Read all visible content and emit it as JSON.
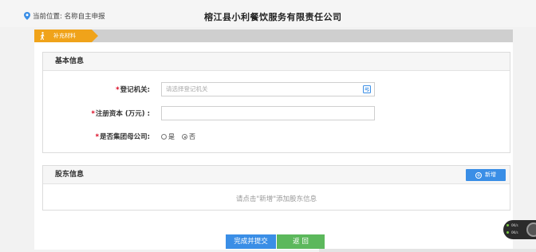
{
  "header": {
    "location_label": "当前位置: 名称自主申报",
    "company_name": "榕江县小利餐饮服务有限责任公司"
  },
  "steps": [
    {
      "label": "补充材料",
      "active": true
    }
  ],
  "basic_info": {
    "title": "基本信息",
    "registration_authority": {
      "required_mark": "*",
      "label": "登记机关:",
      "placeholder": "请选择登记机关"
    },
    "registered_capital": {
      "required_mark": "*",
      "label": "注册资本 (万元) :",
      "value": ""
    },
    "is_group_parent": {
      "required_mark": "*",
      "label": "是否集团母公司:",
      "options": [
        "是",
        "否"
      ],
      "selected": "否"
    }
  },
  "shareholder_info": {
    "title": "股东信息",
    "add_label": "新增",
    "empty_tip": "请点击\"新增\"添加股东信息"
  },
  "actions": {
    "submit_label": "完成并提交",
    "back_label": "返 回"
  },
  "float_widget": {
    "line1": "0K/s",
    "line2": "0K/s"
  },
  "colors": {
    "step_active": "#f0a31a",
    "primary_button": "#3a8ee6",
    "back_button": "#5cb85c",
    "required": "#d9001b"
  }
}
